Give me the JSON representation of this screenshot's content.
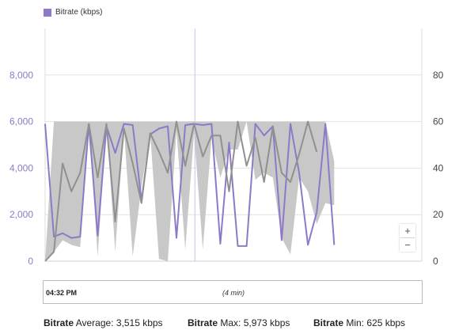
{
  "legend": {
    "label": "Bitrate (kbps)",
    "color": "#8e79c9"
  },
  "timeline": {
    "start_label": "04:32 PM",
    "duration_label": "(4 min)"
  },
  "stats": {
    "avg": {
      "label": "Bitrate",
      "text": " Average: 3,515 kbps"
    },
    "max": {
      "label": "Bitrate",
      "text": " Max: 5,973 kbps"
    },
    "min": {
      "label": "Bitrate",
      "text": " Min: 625 kbps"
    }
  },
  "zoom": {
    "in_label": "+",
    "out_label": "−"
  },
  "colors": {
    "bitrate": "#8e79c9",
    "secondary": "#909090",
    "band": "#c8c8c8",
    "grid": "#e2e2e2",
    "cursor": "#c8c0ea"
  },
  "chart_data": {
    "type": "line",
    "title": "",
    "left_axis": {
      "ylim": [
        0,
        10000
      ],
      "ticks": [
        0,
        2000,
        4000,
        6000,
        8000
      ],
      "tick_labels": [
        "0",
        "2,000",
        "4,000",
        "6,000",
        "8,000"
      ]
    },
    "right_axis": {
      "ylim": [
        0,
        100
      ],
      "ticks": [
        0,
        20,
        40,
        60,
        80
      ],
      "tick_labels": [
        "0",
        "20",
        "40",
        "60",
        "80"
      ]
    },
    "grid": true,
    "x": [
      0,
      1,
      2,
      3,
      4,
      5,
      6,
      7,
      8,
      9,
      10,
      11,
      12,
      13,
      14,
      15,
      16,
      17,
      18,
      19,
      20,
      21,
      22,
      23,
      24,
      25,
      26,
      27,
      28,
      29,
      30,
      31,
      32,
      33,
      34,
      35,
      36,
      37,
      38,
      39,
      40,
      41,
      42,
      43
    ],
    "cursor_x": 17.1,
    "series": [
      {
        "name": "Bitrate (kbps)",
        "axis": "left",
        "values": [
          5900,
          1050,
          1200,
          1000,
          1050,
          5900,
          1100,
          5800,
          4650,
          5900,
          5850,
          2600,
          5450,
          5700,
          5800,
          1000,
          5850,
          5900,
          5850,
          5900,
          750,
          5100,
          650,
          650,
          5900,
          5400,
          5800,
          900,
          5900,
          3800,
          700,
          2100,
          5900,
          700
        ]
      },
      {
        "name": "",
        "axis": "right",
        "values": [
          0,
          4,
          42,
          30,
          38,
          59,
          36,
          59,
          17,
          57,
          42,
          25,
          55,
          47,
          38,
          60,
          41,
          59,
          45,
          54,
          54,
          30,
          60,
          41,
          53,
          34,
          58,
          38,
          34,
          46,
          60,
          47
        ]
      },
      {
        "name": "",
        "axis": "right",
        "band": true,
        "upper": [
          0,
          60,
          60,
          60,
          60,
          60,
          60,
          60,
          60,
          60,
          60,
          60,
          60,
          60,
          60,
          60,
          60,
          60,
          60,
          60,
          60,
          60,
          60,
          60,
          60,
          60,
          60,
          60,
          60,
          60,
          60,
          60,
          60,
          43,
          41,
          60,
          60,
          47
        ],
        "lower": [
          0,
          4,
          9,
          7,
          6,
          60,
          2,
          59,
          4,
          57,
          2,
          32,
          55,
          1,
          0,
          56,
          5,
          55,
          5,
          53,
          36,
          48,
          48,
          60,
          35,
          38,
          36,
          10,
          3,
          36,
          30,
          16,
          25,
          24
        ]
      }
    ]
  }
}
